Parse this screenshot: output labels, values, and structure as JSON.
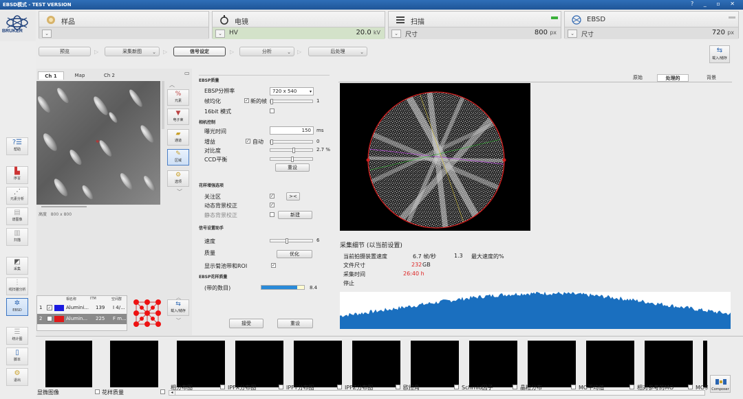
{
  "titlebar": {
    "title": "EBSD模式 - TEST VERSION",
    "controls": "? _ ▫ ✕"
  },
  "brand": {
    "name": "BRUKER"
  },
  "header": {
    "sample": {
      "label": "样品"
    },
    "microscope": {
      "label": "电镜",
      "sub_label": "HV",
      "value": "20.0",
      "unit": "kV"
    },
    "scan": {
      "label": "扫描",
      "sub_label": "尺寸",
      "value": "800",
      "unit": "px"
    },
    "ebsd": {
      "label": "EBSD",
      "sub_label": "尺寸",
      "value": "720",
      "unit": "px"
    }
  },
  "workflow": {
    "steps": [
      "预览",
      "采集新图",
      "信号设定",
      "分析",
      "后处理"
    ],
    "active": "信号设定",
    "right_button": "载入/储存"
  },
  "sidebar": {
    "help": "帮助",
    "items": [
      "序言",
      "元素分析",
      "谱图像",
      "扫描",
      "采集",
      "线扫描分析",
      "EBSD",
      "统计图",
      "脚本",
      "退出"
    ]
  },
  "left_panel": {
    "tabs": [
      "Ch 1",
      "Map",
      "Ch 2"
    ],
    "active_tab": "Ch 1",
    "tools": [
      "元素",
      "电子束",
      "通道",
      "区域",
      "选项"
    ],
    "size_label": "高度",
    "size_value": "800 x 800",
    "phase_table": {
      "headers": [
        "相名称",
        "ITM",
        "空间群"
      ],
      "rows": [
        {
          "index": "1",
          "checked": true,
          "color": "#1a1ae0",
          "name": "Alumini...",
          "itm": "139",
          "group": "I 4/..."
        },
        {
          "index": "2",
          "checked": false,
          "color": "#e01818",
          "name": "Alumin...",
          "itm": "225",
          "group": "F m..."
        }
      ]
    },
    "phase_button": "载入/储存"
  },
  "settings": {
    "ebsp_quality": {
      "title": "EBSP质量",
      "resolution_label": "EBSP分辨率",
      "resolution_value": "720 x 540",
      "frame_avg_label": "帧均化",
      "new_frame_label": "新的帧",
      "frame_avg_value": "1",
      "bit16_label": "16bit 模式"
    },
    "camera": {
      "title": "相机控制",
      "exposure_label": "曝光时间",
      "exposure_value": "150",
      "exposure_unit": "ms",
      "gain_label": "增益",
      "auto_label": "自动",
      "gain_value": "0",
      "contrast_label": "对比度",
      "contrast_value": "2.7 %",
      "ccd_label": "CCD平衡",
      "reset_label": "重设"
    },
    "pattern": {
      "title": "花样增强选项",
      "roi_label": "关注区",
      "roi_btn": "><",
      "dynamic_label": "动态背景校正",
      "static_label": "静态背景校正",
      "new_btn": "新建"
    },
    "wizard": {
      "title": "信号设置助手",
      "speed_label": "速度",
      "speed_value": "6",
      "quality_label": "质量",
      "optimize_btn": "优化",
      "show_band_label": "显示菊池带和ROI"
    },
    "pattern_quality": {
      "title": "EBSP花样质量",
      "bands_label": "(带的数目)",
      "bands_value": "8.4",
      "bands_fraction": 0.84
    },
    "accept_btn": "接受",
    "reset_btn": "重设"
  },
  "right_panel": {
    "tabs": [
      "原始",
      "处理的",
      "背景"
    ],
    "active_tab": "处理的",
    "info_title": "采集细节 (以当前设置)",
    "speed_label": "当前拍摄装置速度",
    "speed_value": "6.7 帧/秒",
    "max_speed_value": "1.3",
    "max_speed_label": "最大速度的%",
    "file_size_label": "文件尺寸",
    "file_size_value": "232",
    "file_size_unit": "GB",
    "time_label": "采集时间",
    "time_value": "26:40 h",
    "status": "停止"
  },
  "thumbnails": {
    "labels": [
      "显微图像",
      "花样质量",
      "相分布图",
      "IPFX分布图",
      "IPFY分布图",
      "IPFZ分布图",
      "欧拉角",
      "Schmid因子",
      "晶粒分布",
      "MO平均值",
      "相对参考的MO",
      "MO特"
    ],
    "composer_label": "Composer"
  },
  "colors": {
    "accent": "#2a64b0",
    "histogram": "#1a6fbf",
    "pattern_border": "#d11c1c",
    "quality_bar": "#2a8ad8"
  }
}
